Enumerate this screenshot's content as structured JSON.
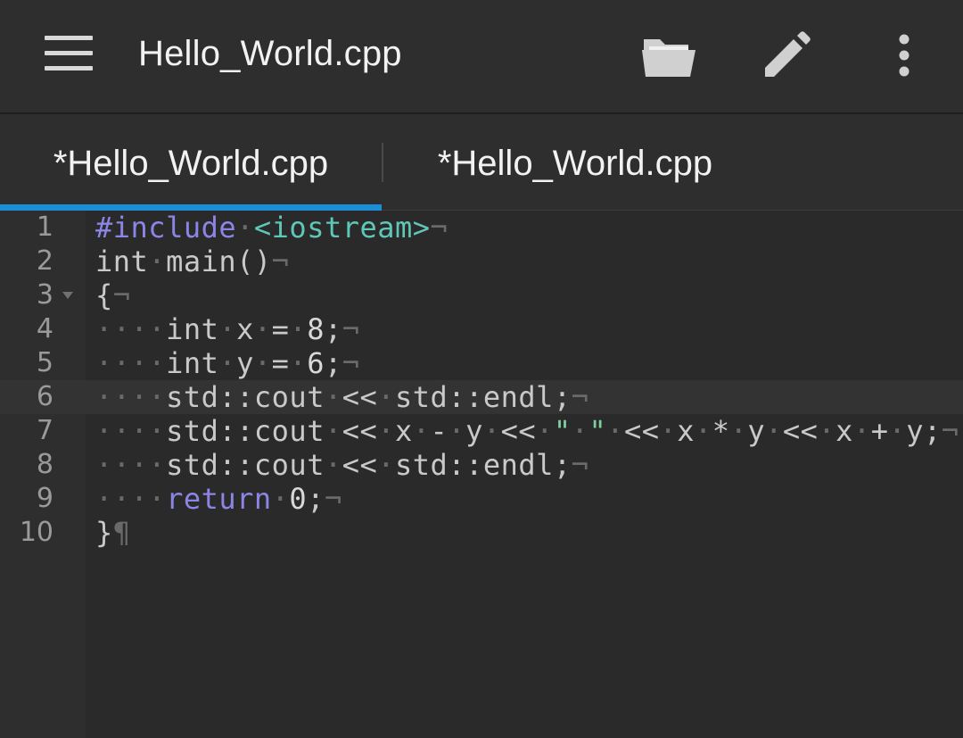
{
  "appbar": {
    "title": "Hello_World.cpp",
    "icons": [
      "menu-icon",
      "folder-open-icon",
      "pencil-icon",
      "more-vert-icon"
    ]
  },
  "tabs": [
    {
      "label": "*Hello_World.cpp",
      "active": true
    },
    {
      "label": "*Hello_World.cpp",
      "active": false
    }
  ],
  "editor": {
    "accent_color": "#1a8fd6",
    "line_numbers": [
      "1",
      "2",
      "3",
      "4",
      "5",
      "6",
      "7",
      "8",
      "9",
      "10"
    ],
    "active_line": 6,
    "lines": [
      "#include <iostream>",
      "int main()",
      "{",
      "    int x = 8;",
      "    int y = 6;",
      "    std::cout << std::endl;",
      "    std::cout << x - y << \" \" << x * y << x + y;",
      "    std::cout << std::endl;",
      "    return 0;",
      "}"
    ]
  }
}
